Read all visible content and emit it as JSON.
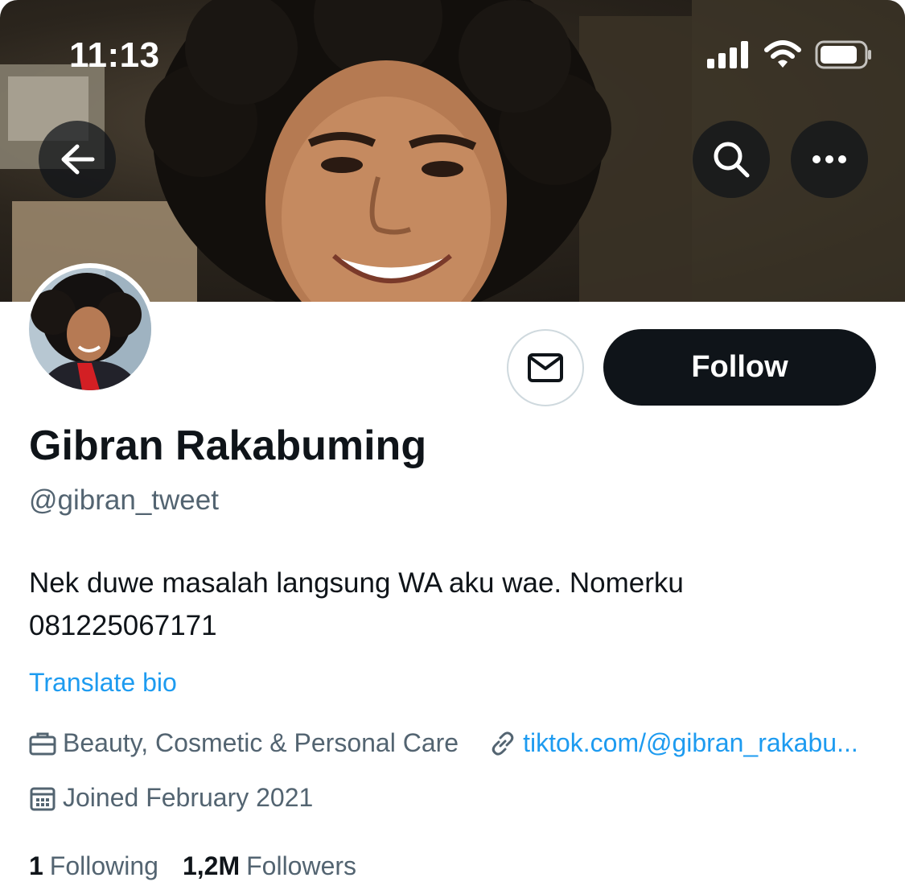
{
  "status_bar": {
    "time": "11:13",
    "icons": [
      "signal-icon",
      "wifi-icon",
      "battery-icon"
    ]
  },
  "header": {
    "buttons": [
      "back-arrow-icon",
      "search-icon",
      "more-icon"
    ]
  },
  "profile": {
    "display_name": "Gibran Rakabuming",
    "handle": "@gibran_tweet",
    "bio": "Nek duwe masalah langsung WA aku wae. Nomerku 081225067171",
    "translate_label": "Translate bio",
    "category": "Beauty, Cosmetic & Personal Care",
    "website": "tiktok.com/@gibran_rakabu...",
    "joined": "Joined February 2021"
  },
  "actions": {
    "follow_label": "Follow",
    "message_icon": "envelope-icon"
  },
  "stats": {
    "following_count": "1",
    "following_label": "Following",
    "followers_count": "1,2M",
    "followers_label": "Followers"
  },
  "colors": {
    "text_primary": "#0f1419",
    "text_secondary": "#536471",
    "link": "#1d9bf0",
    "button_dark": "#0f1419",
    "border": "#cfd9de"
  }
}
